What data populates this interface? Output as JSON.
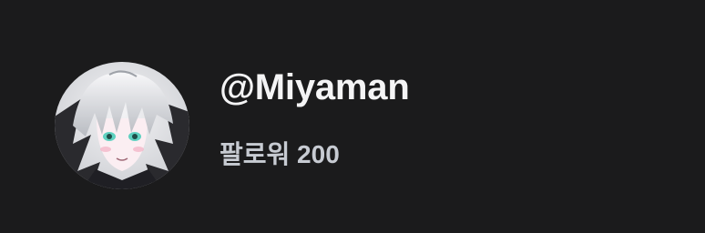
{
  "profile": {
    "username": "@Miyaman",
    "followers_text": "팔로워 200",
    "avatar_icon": "avatar-anime-character"
  },
  "colors": {
    "background": "#1b1b1c",
    "username": "#f4f4f5",
    "followers": "#c7cbd2"
  }
}
